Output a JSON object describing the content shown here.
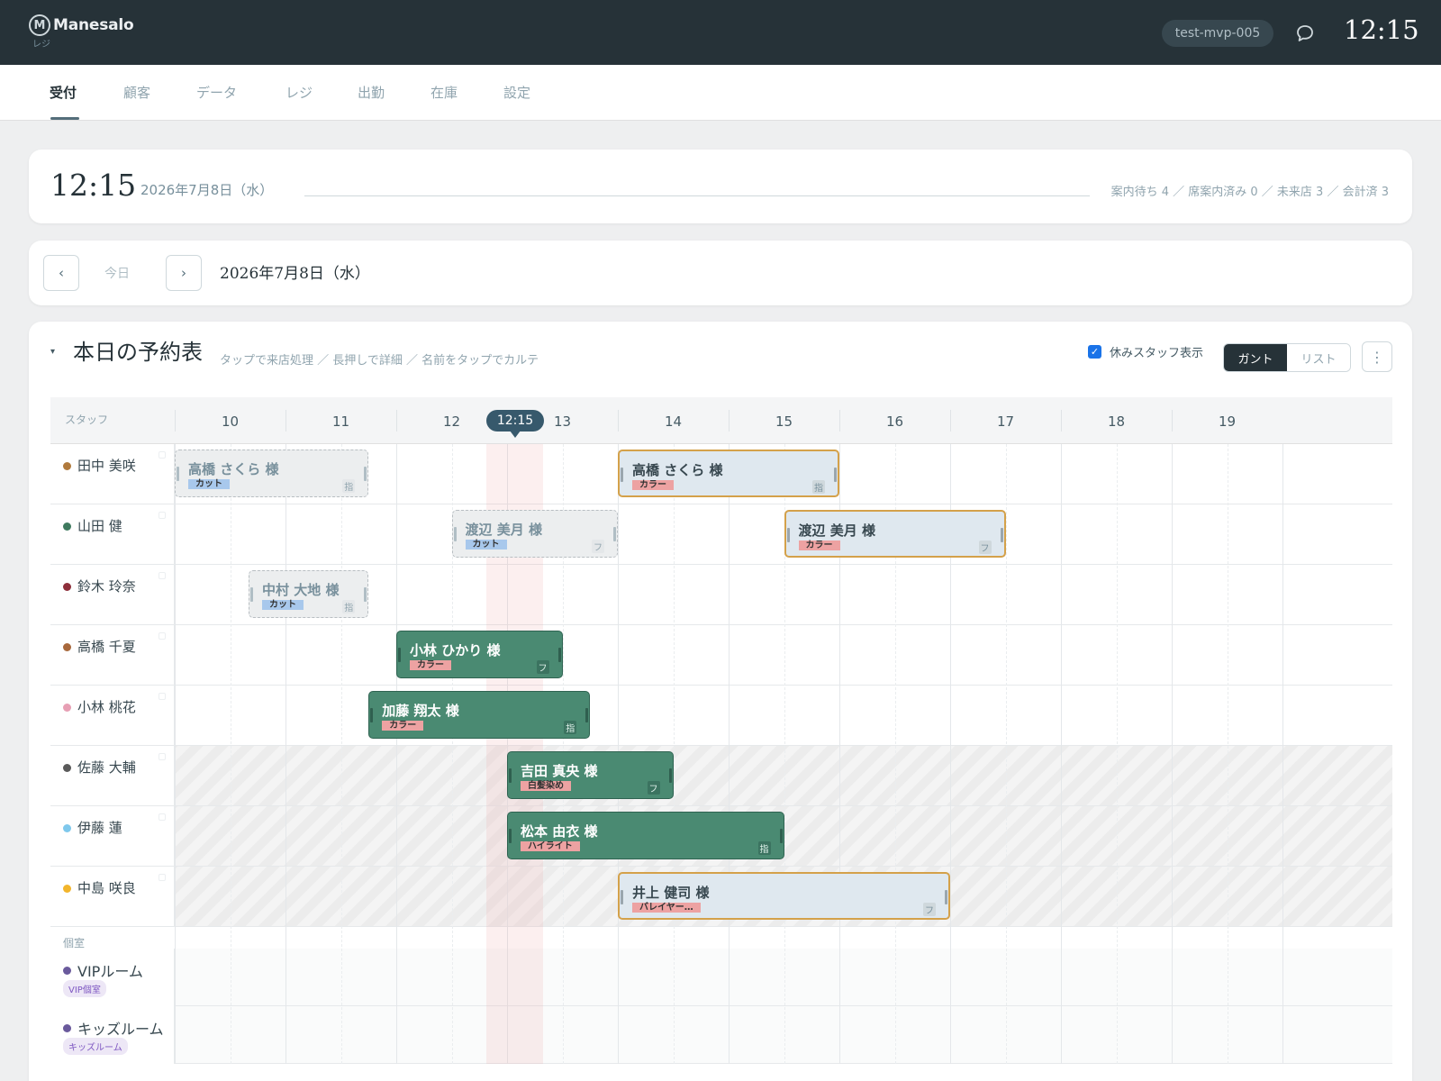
{
  "header": {
    "app_name": "Manesalo",
    "app_sub": "レジ",
    "logo_glyph": "M",
    "env": "test-mvp-005",
    "clock": "12:15",
    "chat_icon": "chat-bubble-icon"
  },
  "tabs": [
    {
      "label": "受付",
      "active": true
    },
    {
      "label": "顧客"
    },
    {
      "label": "データ"
    },
    {
      "label": "レジ"
    },
    {
      "label": "出勤"
    },
    {
      "label": "在庫"
    },
    {
      "label": "設定"
    }
  ],
  "status": {
    "time": "12:15",
    "date": "2026年7月8日（水）",
    "summary": "案内待ち 4 ／ 席案内済み 0 ／ 未来店 3 ／ 会計済 3"
  },
  "date_nav": {
    "prev": "‹",
    "today": "今日",
    "next": "›",
    "date": "2026年7月8日（水）"
  },
  "schedule": {
    "collapse_glyph": "▾",
    "title": "本日の予約表",
    "hint": "タップで来店処理 ／ 長押しで詳細 ／ 名前をタップでカルテ",
    "show_off_staff_label": "休みスタッフ表示",
    "show_off_staff_checked": true,
    "check_glyph": "✓",
    "view_gantt": "ガント",
    "view_list": "リスト",
    "view_selected": "ガント",
    "more_glyph": "⋮"
  },
  "gantt": {
    "staff_header": "スタッフ",
    "hours": [
      "10",
      "11",
      "12",
      "13",
      "14",
      "15",
      "16",
      "17",
      "18",
      "19"
    ],
    "now_label": "12:15",
    "staff": [
      {
        "name": "田中 美咲",
        "color": "#b07a3c",
        "off": false
      },
      {
        "name": "山田 健",
        "color": "#3f7a5e",
        "off": false
      },
      {
        "name": "鈴木 玲奈",
        "color": "#8e2f3b",
        "off": false
      },
      {
        "name": "高橋 千夏",
        "color": "#a8683c",
        "off": false
      },
      {
        "name": "小林 桃花",
        "color": "#e79fb4",
        "off": false
      },
      {
        "name": "佐藤 大輔",
        "color": "#5a5a5a",
        "off": true
      },
      {
        "name": "伊藤 蓮",
        "color": "#7fc8ec",
        "off": true
      },
      {
        "name": "中島 咲良",
        "color": "#f2b52c",
        "off": true
      }
    ],
    "rooms_header": "個室",
    "rooms": [
      {
        "name": "VIPルーム",
        "tag": "VIP個室"
      },
      {
        "name": "キッズルーム",
        "tag": "キッズルーム"
      }
    ],
    "appointments": [
      {
        "staff": 0,
        "start": "10:00",
        "end": "11:45",
        "customer": "高橋 さくら 様",
        "service": "カット",
        "service_color": "blue",
        "flag": "指",
        "state": "done"
      },
      {
        "staff": 0,
        "start": "14:00",
        "end": "16:00",
        "customer": "高橋 さくら 様",
        "service": "カラー",
        "service_color": "red",
        "flag": "指",
        "state": "reserved"
      },
      {
        "staff": 1,
        "start": "12:30",
        "end": "14:00",
        "customer": "渡辺 美月 様",
        "service": "カット",
        "service_color": "blue",
        "flag": "フ",
        "state": "done"
      },
      {
        "staff": 1,
        "start": "15:30",
        "end": "17:30",
        "customer": "渡辺 美月 様",
        "service": "カラー",
        "service_color": "red",
        "flag": "フ",
        "state": "reserved"
      },
      {
        "staff": 2,
        "start": "10:40",
        "end": "11:45",
        "customer": "中村 大地 様",
        "service": "カット",
        "service_color": "blue",
        "flag": "指",
        "state": "done"
      },
      {
        "staff": 3,
        "start": "12:00",
        "end": "13:30",
        "customer": "小林 ひかり 様",
        "service": "カラー",
        "service_color": "red",
        "flag": "フ",
        "state": "active"
      },
      {
        "staff": 4,
        "start": "11:45",
        "end": "13:45",
        "customer": "加藤 翔太 様",
        "service": "カラー",
        "service_color": "red",
        "flag": "指",
        "state": "active"
      },
      {
        "staff": 5,
        "start": "13:00",
        "end": "14:30",
        "customer": "吉田 真央 様",
        "service": "白髪染め",
        "service_color": "red",
        "flag": "フ",
        "state": "active"
      },
      {
        "staff": 6,
        "start": "13:00",
        "end": "15:30",
        "customer": "松本 由衣 様",
        "service": "ハイライト",
        "service_color": "red",
        "flag": "指",
        "state": "active"
      },
      {
        "staff": 7,
        "start": "14:00",
        "end": "17:00",
        "customer": "井上 健司 様",
        "service": "バレイヤー…",
        "service_color": "red",
        "flag": "フ",
        "state": "reserved"
      }
    ]
  }
}
